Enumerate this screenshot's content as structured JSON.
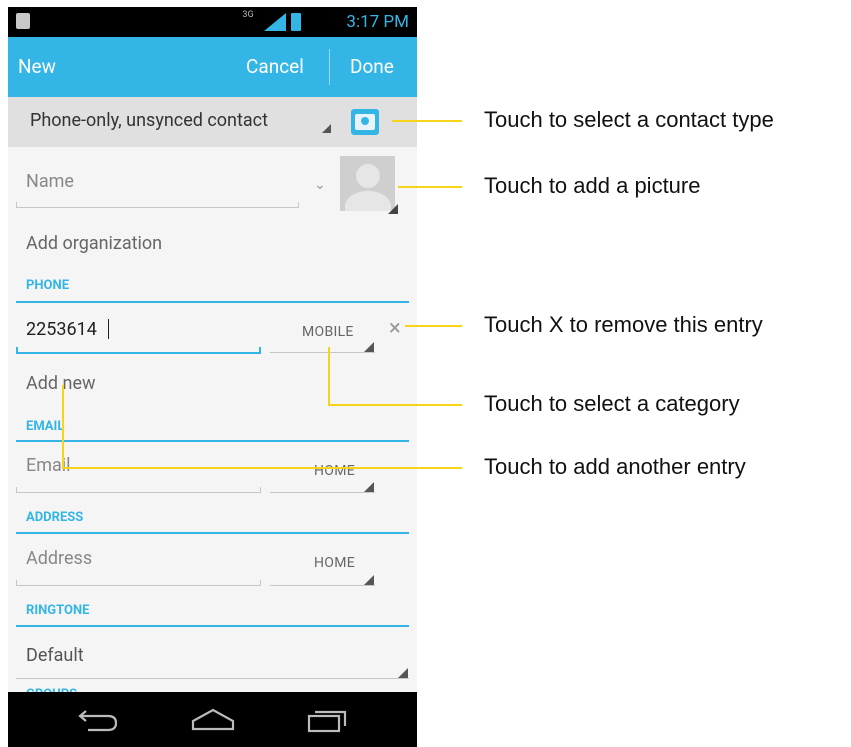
{
  "statusbar": {
    "network": "3G",
    "time": "3:17 PM"
  },
  "actionbar": {
    "new_label": "New",
    "cancel_label": "Cancel",
    "done_label": "Done"
  },
  "contact_type": {
    "selected": "Phone-only, unsynced contact"
  },
  "form": {
    "name_placeholder": "Name",
    "add_organization": "Add organization",
    "phone": {
      "header": "PHONE",
      "value": "2253614",
      "category": "MOBILE",
      "add_new": "Add new"
    },
    "email": {
      "header": "EMAIL",
      "placeholder": "Email",
      "category": "HOME"
    },
    "address": {
      "header": "ADDRESS",
      "placeholder": "Address",
      "category": "HOME"
    },
    "ringtone": {
      "header": "RINGTONE",
      "value": "Default"
    },
    "groups": {
      "header": "GROUPS"
    }
  },
  "navbar": {
    "icons": [
      "back-icon",
      "home-icon",
      "recent-apps-icon"
    ]
  },
  "callouts": [
    "Touch to select a contact type",
    "Touch to add a picture",
    "Touch X to remove this entry",
    "Touch to select a category",
    "Touch to add another entry"
  ],
  "colors": {
    "accent": "#33b5e5",
    "callout_line": "#f7d417",
    "statusbar": "#000000",
    "background": "#f5f5f5"
  }
}
